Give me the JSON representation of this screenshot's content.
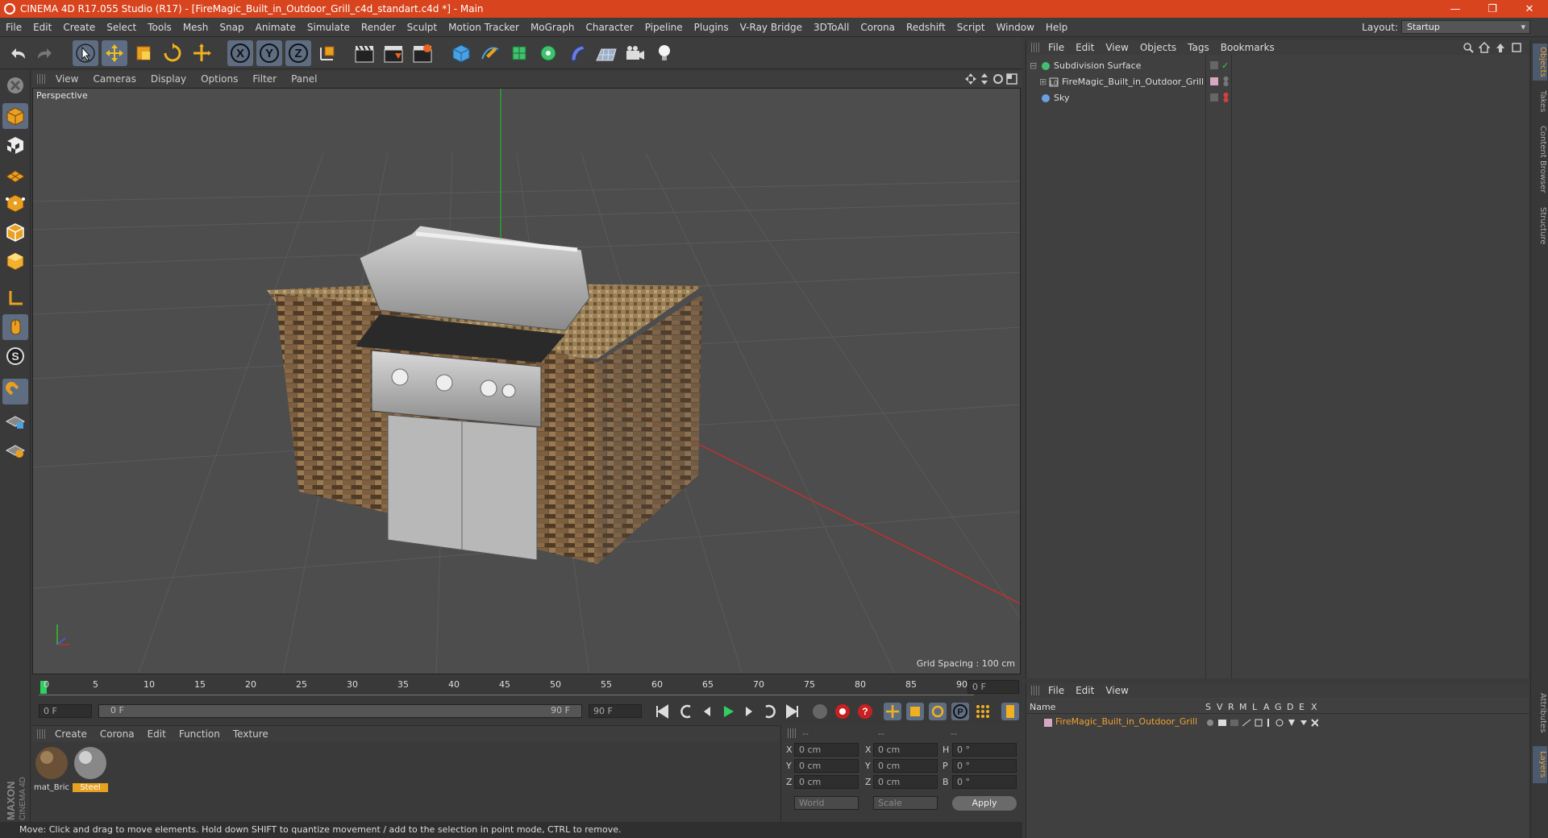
{
  "window": {
    "title": "CINEMA 4D R17.055 Studio (R17) - [FireMagic_Built_in_Outdoor_Grill_c4d_standart.c4d *] - Main",
    "minimize": "—",
    "restore": "❐",
    "close": "✕"
  },
  "menu": [
    "File",
    "Edit",
    "Create",
    "Select",
    "Tools",
    "Mesh",
    "Snap",
    "Animate",
    "Simulate",
    "Render",
    "Sculpt",
    "Motion Tracker",
    "MoGraph",
    "Character",
    "Pipeline",
    "Plugins",
    "V-Ray Bridge",
    "3DToAll",
    "Corona",
    "Redshift",
    "Script",
    "Window",
    "Help"
  ],
  "layout": {
    "label": "Layout:",
    "value": "Startup"
  },
  "viewport": {
    "menu": [
      "View",
      "Cameras",
      "Display",
      "Options",
      "Filter",
      "Panel"
    ],
    "label": "Perspective",
    "grid_spacing": "Grid Spacing : 100 cm"
  },
  "timeline": {
    "ticks": [
      "0",
      "5",
      "10",
      "15",
      "20",
      "25",
      "30",
      "35",
      "40",
      "45",
      "50",
      "55",
      "60",
      "65",
      "70",
      "75",
      "80",
      "85",
      "90"
    ],
    "current": "0 F",
    "start": "0 F",
    "range_start": "0 F",
    "range_end": "90 F",
    "end": "90 F"
  },
  "materials": {
    "menu": [
      "Create",
      "Corona",
      "Edit",
      "Function",
      "Texture"
    ],
    "items": [
      {
        "name": "mat_Bric"
      },
      {
        "name": "Steel"
      }
    ]
  },
  "coords": {
    "headers": [
      "--",
      "--",
      "--"
    ],
    "rows": [
      {
        "a": "X",
        "av": "0 cm",
        "b": "X",
        "bv": "0 cm",
        "c": "H",
        "cv": "0 °"
      },
      {
        "a": "Y",
        "av": "0 cm",
        "b": "Y",
        "bv": "0 cm",
        "c": "P",
        "cv": "0 °"
      },
      {
        "a": "Z",
        "av": "0 cm",
        "b": "Z",
        "bv": "0 cm",
        "c": "B",
        "cv": "0 °"
      }
    ],
    "world": "World",
    "scale": "Scale",
    "apply": "Apply"
  },
  "status": "Move: Click and drag to move elements. Hold down SHIFT to quantize movement / add to the selection in point mode, CTRL to remove.",
  "objects": {
    "menu": [
      "File",
      "Edit",
      "View",
      "Objects",
      "Tags",
      "Bookmarks"
    ],
    "items": [
      "Subdivision Surface",
      "FireMagic_Built_in_Outdoor_Grill",
      "Sky"
    ]
  },
  "attributes": {
    "menu": [
      "File",
      "Edit",
      "View"
    ],
    "columns": [
      "Name",
      "S",
      "V",
      "R",
      "M",
      "L",
      "A",
      "G",
      "D",
      "E",
      "X"
    ],
    "row": "FireMagic_Built_in_Outdoor_Grill"
  },
  "side_tabs": [
    "Objects",
    "Takes",
    "Content Browser",
    "Structure",
    "Attributes",
    "Layers"
  ],
  "brand": "MAXON CINEMA 4D"
}
